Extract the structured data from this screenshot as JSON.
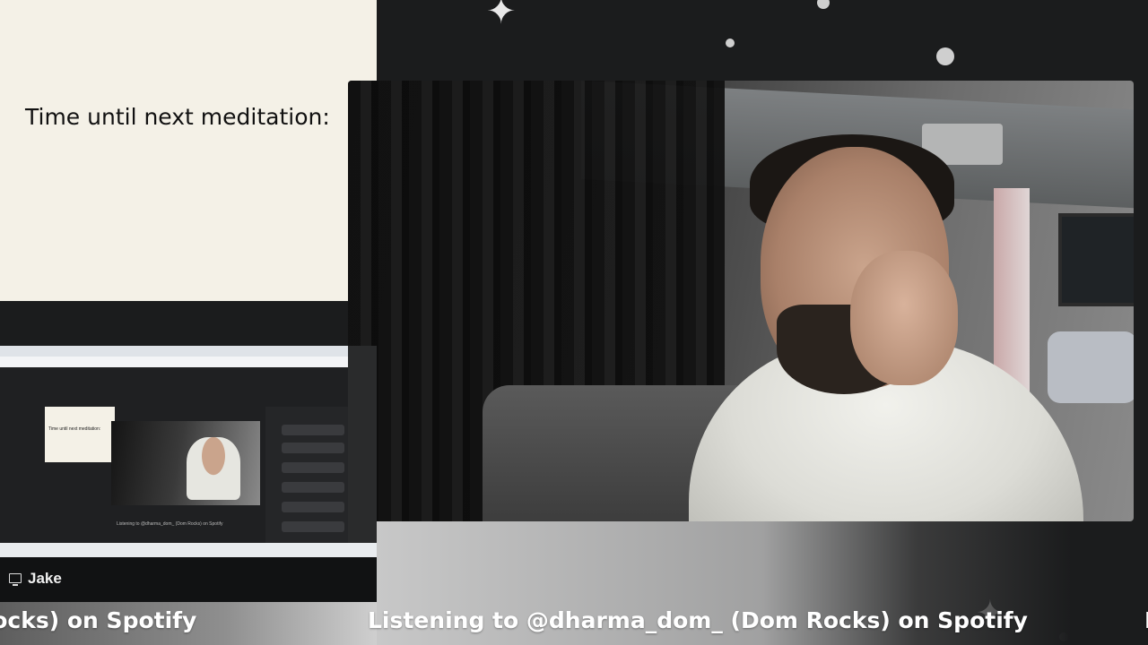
{
  "slide": {
    "text": "Time until next meditation:"
  },
  "participant": {
    "name": "Jake",
    "icon": "monitor-icon"
  },
  "ticker": {
    "full": "Listening to @dharma_dom_ (Dom Rocks) on Spotify",
    "partial_left": "Rocks) on Spotify",
    "partial_right": "L"
  },
  "share_preview": {
    "slide_text": "Time until next meditation:",
    "ticker_text": "Listening to @dharma_dom_ (Dom Rocks) on Spotify"
  },
  "colors": {
    "background": "#1b1c1d",
    "slide_bg": "#f4f1e7",
    "text_white": "#ffffff"
  }
}
